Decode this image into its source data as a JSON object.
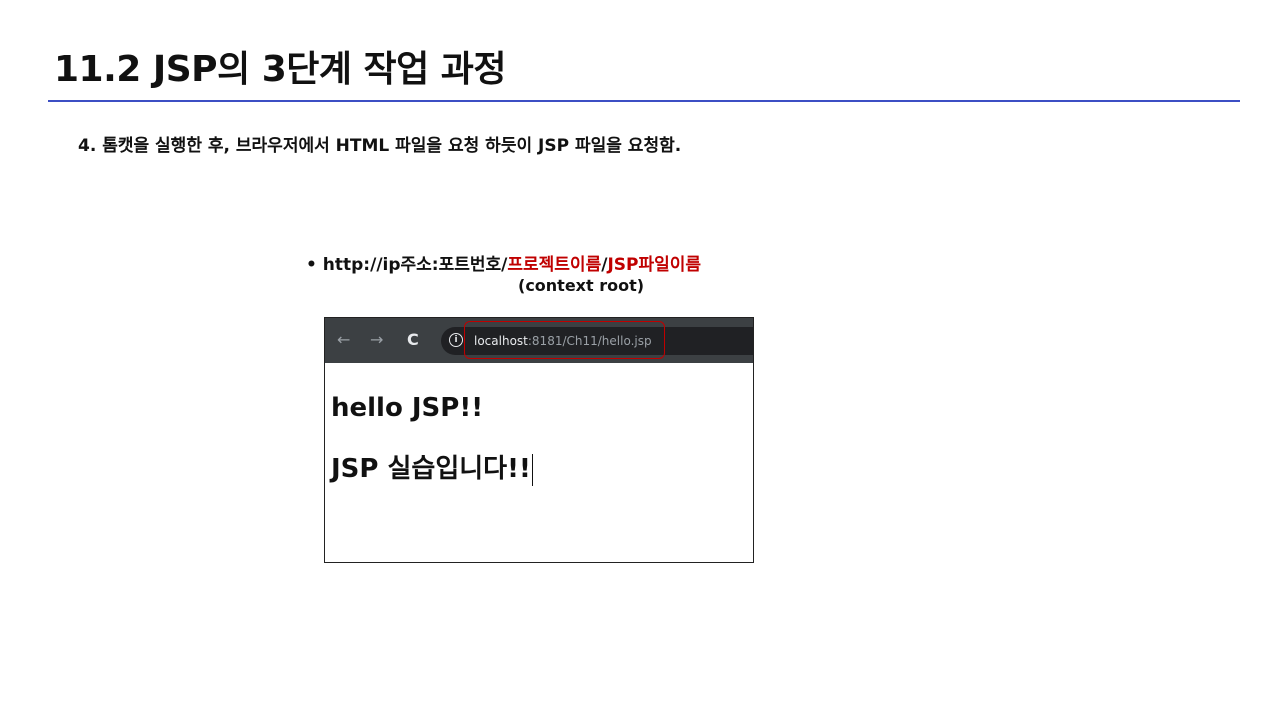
{
  "slide": {
    "title": "11.2 JSP의 3단계 작업 과정",
    "step_text": "4. 톰캣을 실행한 후, 브라우저에서 HTML 파일을 요청 하듯이 JSP 파일을 요청함.",
    "url_pattern": {
      "prefix": "• http://ip주소:포트번호/",
      "project_name": "프로젝트이름",
      "separator": "/",
      "jsp_file_name": "JSP파일이름",
      "context_root_note": "(context root)"
    },
    "accent_color": "#c00000",
    "rule_color": "#3c4fc4"
  },
  "browser": {
    "nav": {
      "back_icon": "←",
      "forward_icon": "→",
      "reload_icon": "C",
      "info_icon": "i"
    },
    "address": {
      "host": "localhost",
      "path": ":8181/Ch11/hello.jsp"
    },
    "page": {
      "line1": "hello JSP!!",
      "line2": "JSP 실습입니다!!"
    }
  }
}
